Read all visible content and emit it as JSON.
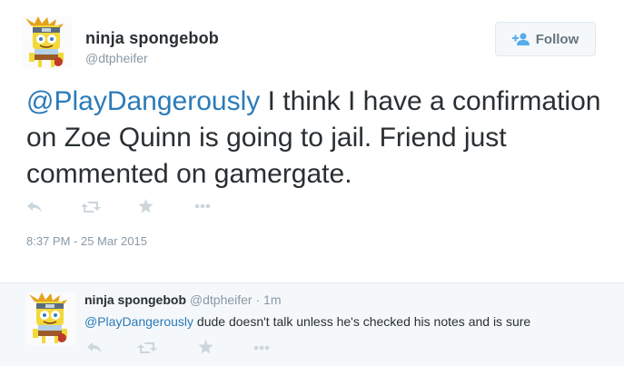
{
  "main_tweet": {
    "fullname": "ninja spongebob",
    "username": "@dtpheifer",
    "follow_label": "Follow",
    "text_mention": "@PlayDangerously",
    "text_body": " I think I have a confirmation on Zoe Quinn is going to jail. Friend just commented on gamergate.",
    "timestamp": "8:37 PM - 25 Mar 2015",
    "actions": [
      "reply-icon",
      "retweet-icon",
      "favorite-icon",
      "more-icon"
    ]
  },
  "reply_tweet": {
    "fullname": "ninja spongebob",
    "username": "@dtpheifer",
    "separator": "·",
    "age": "1m",
    "text_mention": "@PlayDangerously",
    "text_body": " dude doesn't talk unless he's checked his notes and is sure",
    "actions": [
      "reply-icon",
      "retweet-icon",
      "favorite-icon",
      "more-icon"
    ]
  },
  "colors": {
    "link": "#2b7bb9",
    "text": "#292f33",
    "muted": "#8899a6",
    "icon": "#ccd6dd",
    "reply_bg": "#f5f8fa",
    "follow_icon": "#55acee"
  }
}
